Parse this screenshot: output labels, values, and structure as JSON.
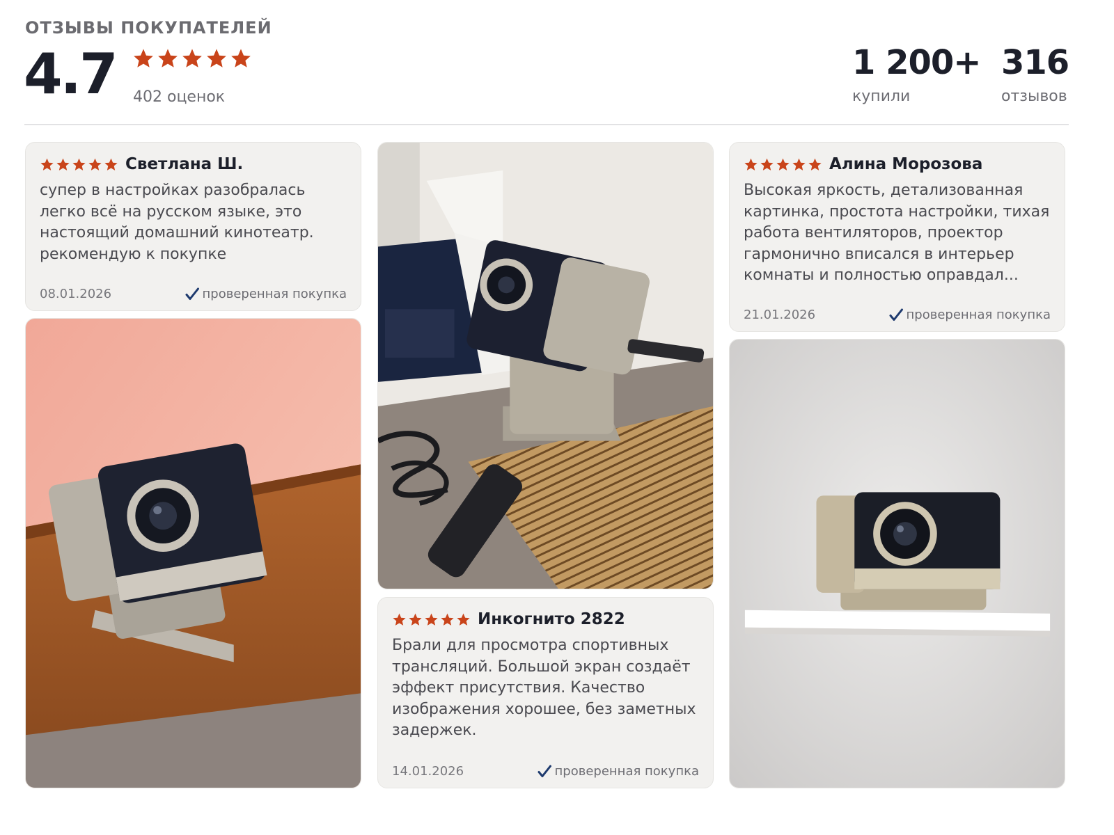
{
  "header": {
    "label": "ОТЗЫВЫ ПОКУПАТЕЛЕЙ",
    "rating": "4.7",
    "rating_value": 4.7,
    "ratings_count": "402 оценок",
    "bought_number": "1 200+",
    "bought_label": "купили",
    "reviews_number": "316",
    "reviews_label": "отзывов"
  },
  "colors": {
    "star": "#c9441a",
    "check": "#1e3a6e",
    "card_bg": "#f2f1ef"
  },
  "icons": {
    "star": "star-icon",
    "verified": "checkmark-icon"
  },
  "reviews": [
    {
      "author": "Светлана Ш.",
      "stars": 5,
      "text": "супер  в настройках разобралась легко всё на русском языке, это настоящий домашний кинотеатр. рекомендую к покупке",
      "date": "08.01.2026",
      "verified": "проверенная покупка"
    },
    {
      "author": "Инкогнито 2822",
      "stars": 5,
      "text": "Брали для просмотра спортивных трансляций. Большой экран создаёт эффект присутствия. Качество изображения хорошее, без заметных задержек.",
      "date": "14.01.2026",
      "verified": "проверенная покупка"
    },
    {
      "author": "Алина Морозова",
      "stars": 5,
      "text": "Высокая яркость, детализованная картинка, простота настройки, тихая работа вентиляторов, проектор гармонично вписался в интерьер комнаты и полностью оправдал...",
      "date": "21.01.2026",
      "verified": "проверенная покупка"
    }
  ]
}
